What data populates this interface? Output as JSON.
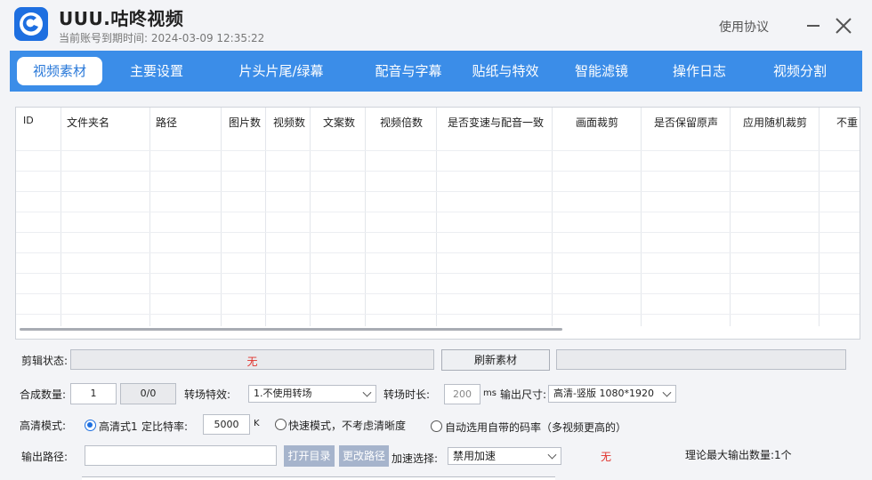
{
  "app": {
    "title": "UUU.咕咚视频",
    "expire_text": "当前账号到期时间: 2024-03-09 12:35:22",
    "agreement": "使用协议"
  },
  "tabs": [
    {
      "label": "视频素材",
      "active": true
    },
    {
      "label": "主要设置",
      "active": false
    },
    {
      "label": "片头片尾/绿幕",
      "active": false
    },
    {
      "label": "配音与字幕",
      "active": false
    },
    {
      "label": "贴纸与特效",
      "active": false
    },
    {
      "label": "智能滤镜",
      "active": false
    },
    {
      "label": "操作日志",
      "active": false
    },
    {
      "label": "视频分割",
      "active": false
    }
  ],
  "table": {
    "columns": [
      "ID",
      "文件夹名",
      "路径",
      "图片数",
      "视频数",
      "文案数",
      "视频倍数",
      "是否变速与配音一致",
      "画面裁剪",
      "是否保留原声",
      "应用随机裁剪",
      "不重"
    ]
  },
  "status": {
    "label": "剪辑状态:",
    "value": "无",
    "refresh_button": "刷新素材"
  },
  "compose": {
    "count_label": "合成数量:",
    "count_value": "1",
    "progress": "0/0",
    "transition_label": "转场特效:",
    "transition_value": "1.不使用转场",
    "duration_label": "转场时长:",
    "duration_value": "200",
    "duration_unit": "ms",
    "size_label": "输出尺寸:",
    "size_value": "高清-竖版 1080*1920"
  },
  "hd": {
    "label": "高清模式:",
    "option1": "高清式1",
    "bitrate_label": "定比特率:",
    "bitrate_value": "5000",
    "bitrate_unit": "K",
    "option2": "快速模式，不考虑清晰度",
    "option3": "自动选用自带的码率（多视频更高的）"
  },
  "output": {
    "label": "输出路径:",
    "path_value": "",
    "open_dir_button": "打开目录",
    "change_path_button": "更改路径",
    "accel_label": "加速选择:",
    "accel_value": "禁用加速",
    "accel_status": "无",
    "max_text": "理论最大输出数量:1个"
  },
  "colors": {
    "accent": "#3b8de8",
    "active_tab_text": "#2a79d9",
    "status_red": "#e0302a"
  }
}
